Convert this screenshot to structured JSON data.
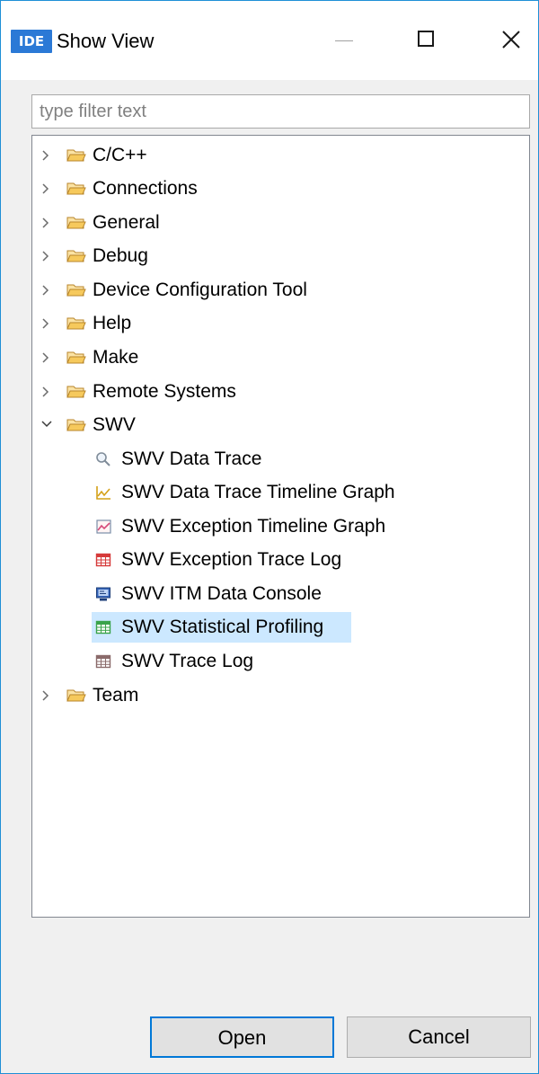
{
  "window": {
    "app_icon_text": "IDE",
    "title": "Show View"
  },
  "filter": {
    "placeholder": "type filter text",
    "value": ""
  },
  "tree": {
    "categories": [
      {
        "label": "C/C++",
        "expanded": false
      },
      {
        "label": "Connections",
        "expanded": false
      },
      {
        "label": "General",
        "expanded": false
      },
      {
        "label": "Debug",
        "expanded": false
      },
      {
        "label": "Device Configuration Tool",
        "expanded": false
      },
      {
        "label": "Help",
        "expanded": false
      },
      {
        "label": "Make",
        "expanded": false
      },
      {
        "label": "Remote Systems",
        "expanded": false
      },
      {
        "label": "SWV",
        "expanded": true
      },
      {
        "label": "Team",
        "expanded": false
      }
    ],
    "swv_children": [
      {
        "label": "SWV Data Trace",
        "icon": "magnifier-icon"
      },
      {
        "label": "SWV Data Trace Timeline Graph",
        "icon": "timeline-graph-icon"
      },
      {
        "label": "SWV Exception Timeline Graph",
        "icon": "exception-graph-icon"
      },
      {
        "label": "SWV Exception Trace Log",
        "icon": "red-table-icon"
      },
      {
        "label": "SWV ITM Data Console",
        "icon": "console-monitor-icon"
      },
      {
        "label": "SWV Statistical Profiling",
        "icon": "green-table-icon",
        "selected": true
      },
      {
        "label": "SWV Trace Log",
        "icon": "gray-table-icon"
      }
    ]
  },
  "buttons": {
    "open_label": "Open",
    "cancel_label": "Cancel"
  },
  "colors": {
    "accent": "#0078d7",
    "selection": "#cce8ff",
    "folder": "#d9a441",
    "app_icon_bg": "#2b79d6"
  }
}
